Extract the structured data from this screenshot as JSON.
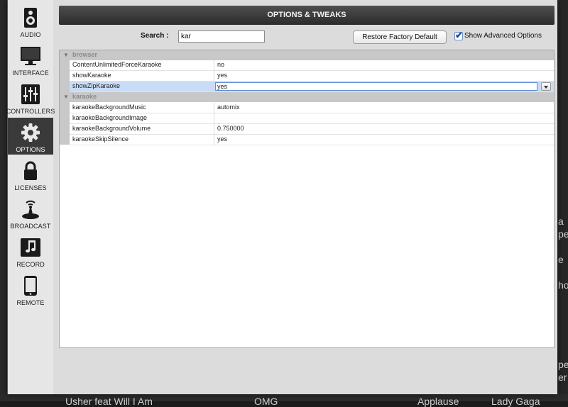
{
  "window": {
    "title": "OPTIONS & TWEAKS"
  },
  "sidebar": {
    "items": [
      {
        "label": "AUDIO",
        "icon": "speaker-icon",
        "active": false
      },
      {
        "label": "INTERFACE",
        "icon": "monitor-icon",
        "active": false
      },
      {
        "label": "CONTROLLERS",
        "icon": "sliders-icon",
        "active": false
      },
      {
        "label": "OPTIONS",
        "icon": "gear-icon",
        "active": true
      },
      {
        "label": "LICENSES",
        "icon": "lock-icon",
        "active": false
      },
      {
        "label": "BROADCAST",
        "icon": "broadcast-icon",
        "active": false
      },
      {
        "label": "RECORD",
        "icon": "music-note-icon",
        "active": false
      },
      {
        "label": "REMOTE",
        "icon": "tablet-icon",
        "active": false
      }
    ]
  },
  "toolbar": {
    "search_label": "Search :",
    "search_value": "kar",
    "restore_label": "Restore Factory Default",
    "advanced_label": "Show Advanced Options",
    "advanced_checked": true
  },
  "groups": [
    {
      "name": "browser",
      "rows": [
        {
          "key": "ContentUnlimitedForceKaraoke",
          "value": "no"
        },
        {
          "key": "showKaraoke",
          "value": "yes"
        },
        {
          "key": "showZipKaraoke",
          "value": "yes",
          "selected": true
        }
      ]
    },
    {
      "name": "karaoke",
      "rows": [
        {
          "key": "karaokeBackgroundMusic",
          "value": "automix"
        },
        {
          "key": "karaokeBackgroundImage",
          "value": ""
        },
        {
          "key": "karaokeBackgroundVolume",
          "value": "0.750000"
        },
        {
          "key": "karaokeSkipSilence",
          "value": "yes"
        }
      ]
    }
  ],
  "background": {
    "right_fragments": [
      "a",
      "pe",
      "e",
      "ho",
      "pe",
      "er"
    ],
    "bottom_row": [
      "Usher feat Will I Am",
      "OMG",
      "Applause",
      "Lady Gaga"
    ]
  },
  "colors": {
    "selection": "#c9dcf7",
    "header": "#3a3a3a",
    "active_nav": "#3a3a3a"
  }
}
